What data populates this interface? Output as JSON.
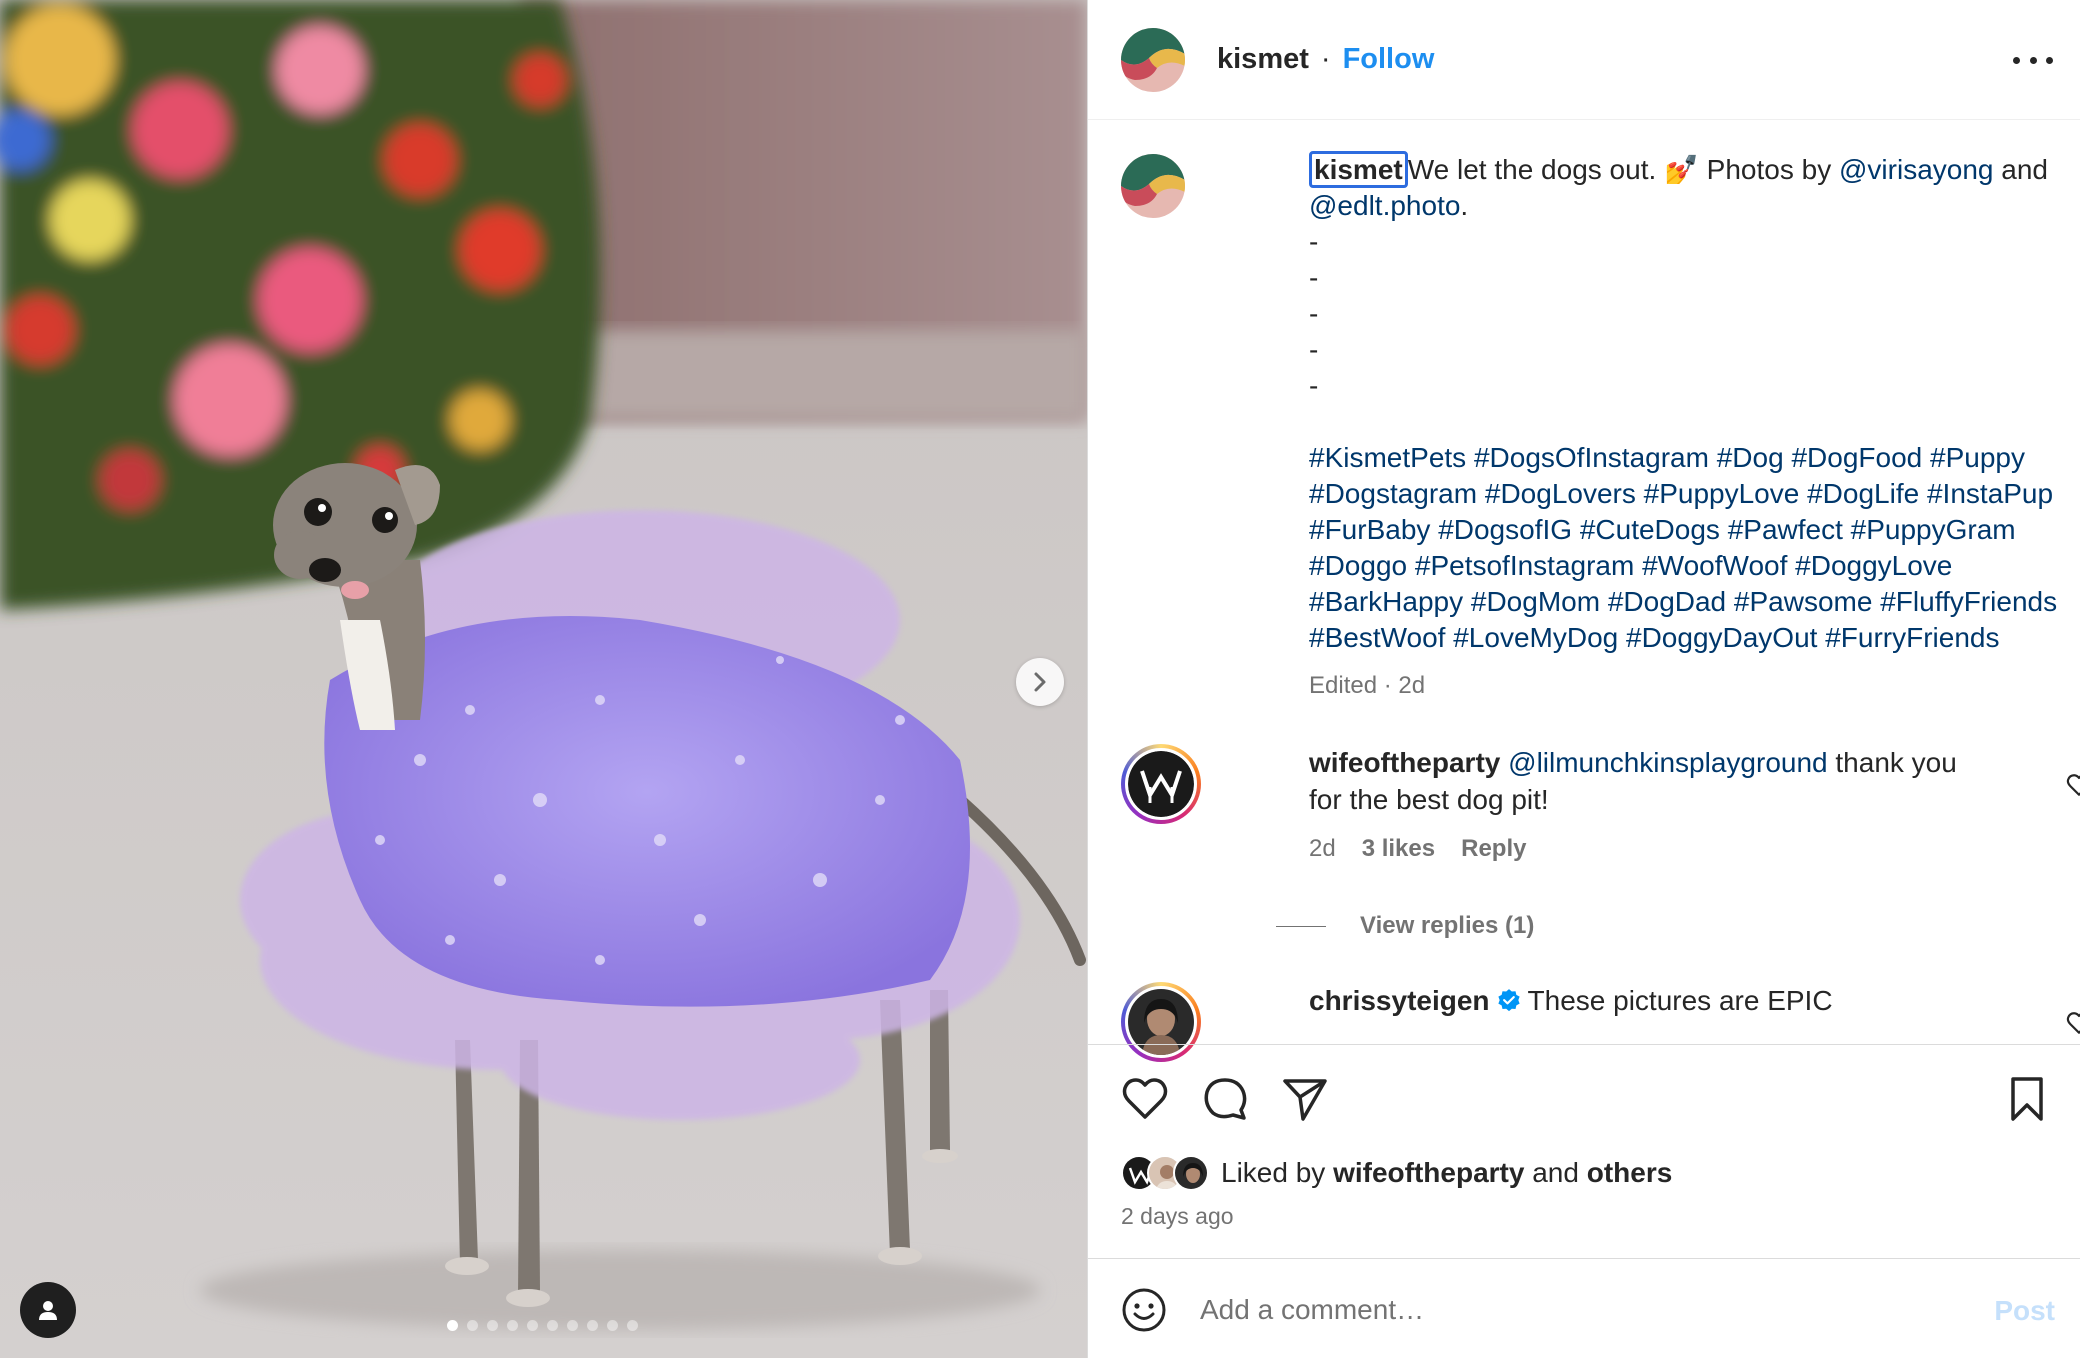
{
  "post": {
    "username": "kismet",
    "separator": "·",
    "follow_label": "Follow",
    "more_icon": "more-horizontal-icon"
  },
  "caption": {
    "username": "kismet",
    "text_1": "We let the dogs out. ",
    "emoji": "💅",
    "text_2": " Photos by ",
    "mention_1": "@virisayong",
    "text_3": " and",
    "mention_2": "@edlt.photo",
    "text_4": ".",
    "dashes": [
      "-",
      "-",
      "-",
      "-",
      "-"
    ],
    "hashtags": [
      "#KismetPets",
      "#DogsOfInstagram",
      "#Dog",
      "#DogFood",
      "#Puppy",
      "#Dogstagram",
      "#DogLovers",
      "#PuppyLove",
      "#DogLife",
      "#InstaPup",
      "#FurBaby",
      "#DogsofIG",
      "#CuteDogs",
      "#Pawfect",
      "#PuppyGram",
      "#Doggo",
      "#PetsofInstagram",
      "#WoofWoof",
      "#DoggyLove",
      "#BarkHappy",
      "#DogMom",
      "#DogDad",
      "#Pawsome",
      "#FluffyFriends",
      "#BestWoof",
      "#LoveMyDog",
      "#DoggyDayOut",
      "#FurryFriends"
    ],
    "meta": "Edited · 2d"
  },
  "comments": [
    {
      "username": "wifeoftheparty",
      "mention": "@lilmunchkinsplayground",
      "text": " thank you for the best dog pit!",
      "time": "2d",
      "likes": "3 likes",
      "reply_label": "Reply",
      "view_replies": "View replies (1)"
    },
    {
      "username": "chrissyteigen",
      "text": "These pictures are EPIC"
    }
  ],
  "actions": {
    "liked_by_prefix": "Liked by",
    "liked_by_user": "wifeoftheparty",
    "liked_by_and": "and",
    "liked_by_others": "others",
    "date": "2 days ago"
  },
  "add_comment": {
    "placeholder": "Add a comment…",
    "post_label": "Post"
  },
  "carousel": {
    "total_slides": 10,
    "active_slide": 1
  },
  "colors": {
    "link": "#00376b",
    "follow": "#1d8ef0",
    "muted": "#737373",
    "post_disabled": "#c5e0fb"
  }
}
